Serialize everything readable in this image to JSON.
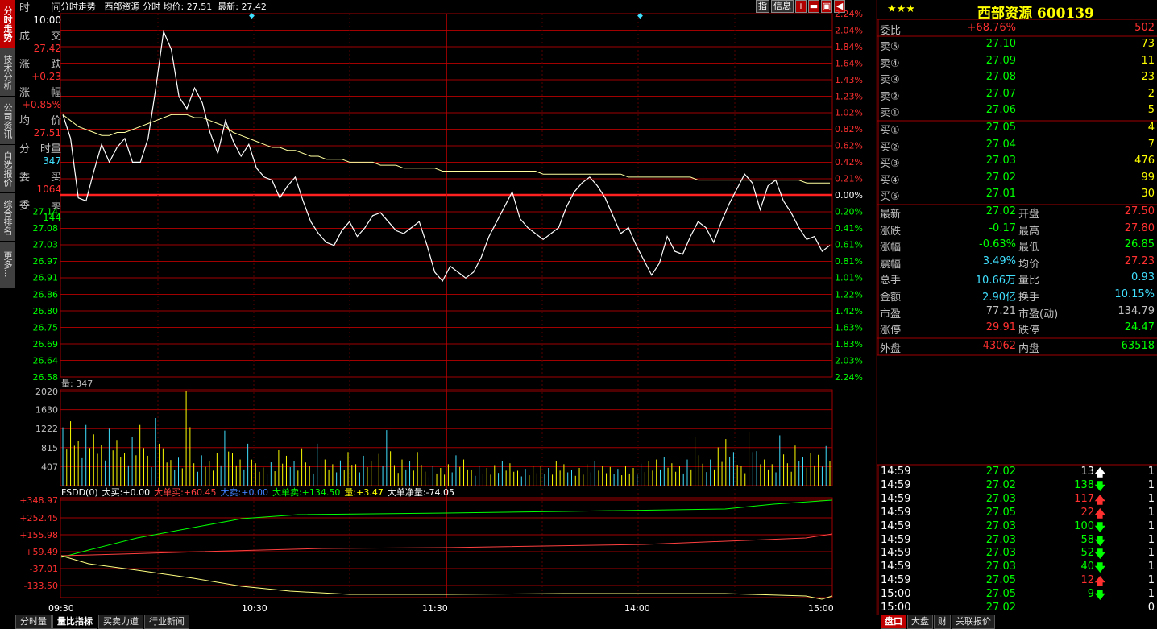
{
  "left_tabs": [
    "分时走势",
    "技术分析",
    "公司资讯",
    "自选报价",
    "综合排名",
    "更多..."
  ],
  "chart_header": {
    "title": "分时走势",
    "stock": "西部资源",
    "mode": "分时",
    "avg_label": "均价:",
    "avg_value": "27.51",
    "last_label": "最新:",
    "last_value": "27.42"
  },
  "top_icons": {
    "zhi": "指",
    "info": "信息"
  },
  "info_box": [
    {
      "l": "时",
      "r": "间",
      "v": "10:00",
      "c": "#ffffff"
    },
    {
      "l": "成",
      "r": "交",
      "v": "27.42",
      "c": "#ff3030"
    },
    {
      "l": "涨",
      "r": "跌",
      "v": "+0.23",
      "c": "#ff3030"
    },
    {
      "l": "涨",
      "r": "幅",
      "v": "+0.85%",
      "c": "#ff3030"
    },
    {
      "l": "均",
      "r": "价",
      "v": "27.51",
      "c": "#ff3030"
    },
    {
      "l": "分",
      "r": "时量",
      "v": "347",
      "c": "#40e0ff"
    },
    {
      "l": "委",
      "r": "买",
      "v": "1064",
      "c": "#ff3030"
    },
    {
      "l": "委",
      "r": "卖",
      "v": "144",
      "c": "#00ff00"
    }
  ],
  "price_axis": {
    "left": [
      "27.14",
      "27.08",
      "27.03",
      "26.97",
      "26.91",
      "26.86",
      "26.80",
      "26.75",
      "26.69",
      "26.64",
      "26.58"
    ],
    "right_up": [
      "2.24%",
      "2.04%",
      "1.84%",
      "1.64%",
      "1.43%",
      "1.23%",
      "1.02%",
      "0.82%",
      "0.62%",
      "0.42%",
      "0.21%"
    ],
    "zero": "0.00%",
    "right_down": [
      "0.20%",
      "0.41%",
      "0.61%",
      "0.81%",
      "1.01%",
      "1.22%",
      "1.42%",
      "1.63%",
      "1.83%",
      "2.03%",
      "2.24%"
    ]
  },
  "volume": {
    "label": "量: 347",
    "axis": [
      "2020",
      "1630",
      "1222",
      "815",
      "407"
    ]
  },
  "fsdd": {
    "title": "FSDD(0)",
    "items": [
      {
        "k": "大买:",
        "v": "+0.00",
        "kc": "#ffffff",
        "vc": "#ffffff"
      },
      {
        "k": "大单买:",
        "v": "+60.45",
        "kc": "#ff4040",
        "vc": "#ff4040"
      },
      {
        "k": "大卖:",
        "v": "+0.00",
        "kc": "#4080ff",
        "vc": "#4080ff"
      },
      {
        "k": "大单卖:",
        "v": "+134.50",
        "kc": "#00ff00",
        "vc": "#00ff00"
      },
      {
        "k": "量:",
        "v": "+3.47",
        "kc": "#ffff00",
        "vc": "#ffff00"
      },
      {
        "k": "大单净量:",
        "v": "-74.05",
        "kc": "#ffffff",
        "vc": "#ffffff"
      }
    ],
    "axis": [
      "+348.97",
      "+252.45",
      "+155.98",
      "+59.49",
      "-37.01",
      "-133.50"
    ]
  },
  "time_axis": [
    "09:30",
    "10:30",
    "11:30",
    "14:00",
    "15:00"
  ],
  "bottom_tabs": [
    "分时量",
    "量比指标",
    "买卖力道",
    "行业新闻"
  ],
  "right_panel": {
    "stars": "★★★",
    "name": "西部资源 600139",
    "weibi": {
      "label": "委比",
      "pct": "+68.76%",
      "val": "502"
    },
    "sell": [
      {
        "l": "卖⑤",
        "p": "27.10",
        "v": "73"
      },
      {
        "l": "卖④",
        "p": "27.09",
        "v": "11"
      },
      {
        "l": "卖③",
        "p": "27.08",
        "v": "23"
      },
      {
        "l": "卖②",
        "p": "27.07",
        "v": "2"
      },
      {
        "l": "卖①",
        "p": "27.06",
        "v": "5"
      }
    ],
    "buy": [
      {
        "l": "买①",
        "p": "27.05",
        "v": "4"
      },
      {
        "l": "买②",
        "p": "27.04",
        "v": "7"
      },
      {
        "l": "买③",
        "p": "27.03",
        "v": "476"
      },
      {
        "l": "买④",
        "p": "27.02",
        "v": "99"
      },
      {
        "l": "买⑤",
        "p": "27.01",
        "v": "30"
      }
    ],
    "stats": [
      {
        "l1": "最新",
        "v1": "27.02",
        "c1": "#00ff00",
        "l2": "开盘",
        "v2": "27.50",
        "c2": "#ff3030"
      },
      {
        "l1": "涨跌",
        "v1": "-0.17",
        "c1": "#00ff00",
        "l2": "最高",
        "v2": "27.80",
        "c2": "#ff3030"
      },
      {
        "l1": "涨幅",
        "v1": "-0.63%",
        "c1": "#00ff00",
        "l2": "最低",
        "v2": "26.85",
        "c2": "#00ff00"
      },
      {
        "l1": "震幅",
        "v1": "3.49%",
        "c1": "#40e0ff",
        "l2": "均价",
        "v2": "27.23",
        "c2": "#ff3030"
      },
      {
        "l1": "总手",
        "v1": "10.66万",
        "c1": "#40e0ff",
        "l2": "量比",
        "v2": "0.93",
        "c2": "#40e0ff"
      },
      {
        "l1": "金额",
        "v1": "2.90亿",
        "c1": "#40e0ff",
        "l2": "换手",
        "v2": "10.15%",
        "c2": "#40e0ff"
      },
      {
        "l1": "市盈",
        "v1": "77.21",
        "c1": "#c0c0c0",
        "l2": "市盈(动)",
        "v2": "134.79",
        "c2": "#c0c0c0"
      },
      {
        "l1": "涨停",
        "v1": "29.91",
        "c1": "#ff3030",
        "l2": "跌停",
        "v2": "24.47",
        "c2": "#00ff00"
      }
    ],
    "outer": {
      "l1": "外盘",
      "v1": "43062",
      "l2": "内盘",
      "v2": "63518"
    },
    "ticks": [
      {
        "t": "14:59",
        "p": "27.02",
        "pc": "#00ff00",
        "v": "13",
        "dir": "up",
        "vc": "#ffffff",
        "n": "1"
      },
      {
        "t": "14:59",
        "p": "27.02",
        "pc": "#00ff00",
        "v": "138",
        "dir": "down",
        "vc": "#00ff00",
        "n": "1"
      },
      {
        "t": "14:59",
        "p": "27.03",
        "pc": "#00ff00",
        "v": "117",
        "dir": "up",
        "vc": "#ff3030",
        "n": "1"
      },
      {
        "t": "14:59",
        "p": "27.05",
        "pc": "#00ff00",
        "v": "22",
        "dir": "up",
        "vc": "#ff3030",
        "n": "1"
      },
      {
        "t": "14:59",
        "p": "27.03",
        "pc": "#00ff00",
        "v": "100",
        "dir": "down",
        "vc": "#00ff00",
        "n": "1"
      },
      {
        "t": "14:59",
        "p": "27.03",
        "pc": "#00ff00",
        "v": "58",
        "dir": "down",
        "vc": "#00ff00",
        "n": "1"
      },
      {
        "t": "14:59",
        "p": "27.03",
        "pc": "#00ff00",
        "v": "52",
        "dir": "down",
        "vc": "#00ff00",
        "n": "1"
      },
      {
        "t": "14:59",
        "p": "27.03",
        "pc": "#00ff00",
        "v": "40",
        "dir": "down",
        "vc": "#00ff00",
        "n": "1"
      },
      {
        "t": "14:59",
        "p": "27.05",
        "pc": "#00ff00",
        "v": "12",
        "dir": "up",
        "vc": "#ff3030",
        "n": "1"
      },
      {
        "t": "15:00",
        "p": "27.05",
        "pc": "#00ff00",
        "v": "9",
        "dir": "down",
        "vc": "#00ff00",
        "n": "1"
      },
      {
        "t": "15:00",
        "p": "27.02",
        "pc": "#00ff00",
        "v": "",
        "dir": "",
        "vc": "#ffffff",
        "n": "0"
      }
    ],
    "tabs": [
      "盘口",
      "大盘",
      "财",
      "关联报价"
    ]
  },
  "chart_data": {
    "type": "line",
    "series": [
      {
        "values": [
          27.46,
          27.38,
          27.18,
          27.17,
          27.27,
          27.36,
          27.3,
          27.35,
          27.38,
          27.3,
          27.3,
          27.38,
          27.55,
          27.74,
          27.68,
          27.52,
          27.48,
          27.55,
          27.5,
          27.4,
          27.33,
          27.44,
          27.37,
          27.32,
          27.36,
          27.28,
          27.25,
          27.24,
          27.18,
          27.22,
          27.25,
          27.17,
          27.1,
          27.06,
          27.03,
          27.02,
          27.07,
          27.1,
          27.05,
          27.08,
          27.12,
          27.13,
          27.1,
          27.07,
          27.06,
          27.08,
          27.1,
          27.02,
          26.93,
          26.9,
          26.95,
          26.93,
          26.91,
          26.93,
          26.98,
          27.05,
          27.1,
          27.15,
          27.2,
          27.11,
          27.08,
          27.06,
          27.04,
          27.06,
          27.08,
          27.15,
          27.2,
          27.23,
          27.25,
          27.22,
          27.18,
          27.12,
          27.06,
          27.08,
          27.02,
          26.97,
          26.92,
          26.96,
          27.05,
          27.0,
          26.99,
          27.05,
          27.1,
          27.08,
          27.03,
          27.1,
          27.16,
          27.21,
          27.26,
          27.23,
          27.14,
          27.22,
          27.24,
          27.17,
          27.13,
          27.08,
          27.04,
          27.05,
          27.0,
          27.02
        ]
      },
      {
        "values": [
          27.46,
          27.44,
          27.42,
          27.41,
          27.4,
          27.39,
          27.39,
          27.4,
          27.4,
          27.41,
          27.42,
          27.43,
          27.44,
          27.45,
          27.46,
          27.46,
          27.46,
          27.45,
          27.45,
          27.44,
          27.43,
          27.42,
          27.4,
          27.39,
          27.38,
          27.37,
          27.36,
          27.35,
          27.35,
          27.34,
          27.34,
          27.33,
          27.32,
          27.32,
          27.31,
          27.31,
          27.31,
          27.3,
          27.3,
          27.3,
          27.3,
          27.29,
          27.29,
          27.29,
          27.28,
          27.28,
          27.28,
          27.28,
          27.28,
          27.27,
          27.27,
          27.27,
          27.27,
          27.27,
          27.27,
          27.27,
          27.27,
          27.27,
          27.27,
          27.27,
          27.27,
          27.27,
          27.26,
          27.26,
          27.26,
          27.26,
          27.26,
          27.26,
          27.26,
          27.26,
          27.26,
          27.26,
          27.26,
          27.25,
          27.25,
          27.25,
          27.25,
          27.25,
          27.25,
          27.25,
          27.25,
          27.25,
          27.24,
          27.24,
          27.24,
          27.24,
          27.24,
          27.24,
          27.24,
          27.24,
          27.24,
          27.24,
          27.24,
          27.24,
          27.24,
          27.24,
          27.23,
          27.23,
          27.23,
          27.23
        ]
      }
    ],
    "volume": [
      1250,
      1380,
      950,
      1300,
      1100,
      870,
      1220,
      980,
      700,
      1050,
      1300,
      640,
      1450,
      800,
      550,
      600,
      2020,
      480,
      650,
      520,
      700,
      1180,
      700,
      560,
      900,
      480,
      390,
      500,
      760,
      640,
      520,
      800,
      420,
      900,
      560,
      460,
      540,
      720,
      460,
      640,
      520,
      680,
      1190,
      440,
      560,
      520,
      720,
      300,
      420,
      380,
      460,
      650,
      560,
      340,
      420,
      380,
      440,
      520,
      480,
      320,
      360,
      430,
      410,
      380,
      520,
      460,
      340,
      380,
      460,
      520,
      430,
      400,
      360,
      420,
      380,
      470,
      520,
      560,
      620,
      480,
      420,
      560,
      1050,
      470,
      560,
      820,
      1000,
      720,
      430,
      1160,
      740,
      560,
      460,
      1080,
      480,
      860,
      620,
      700,
      660,
      850
    ]
  }
}
